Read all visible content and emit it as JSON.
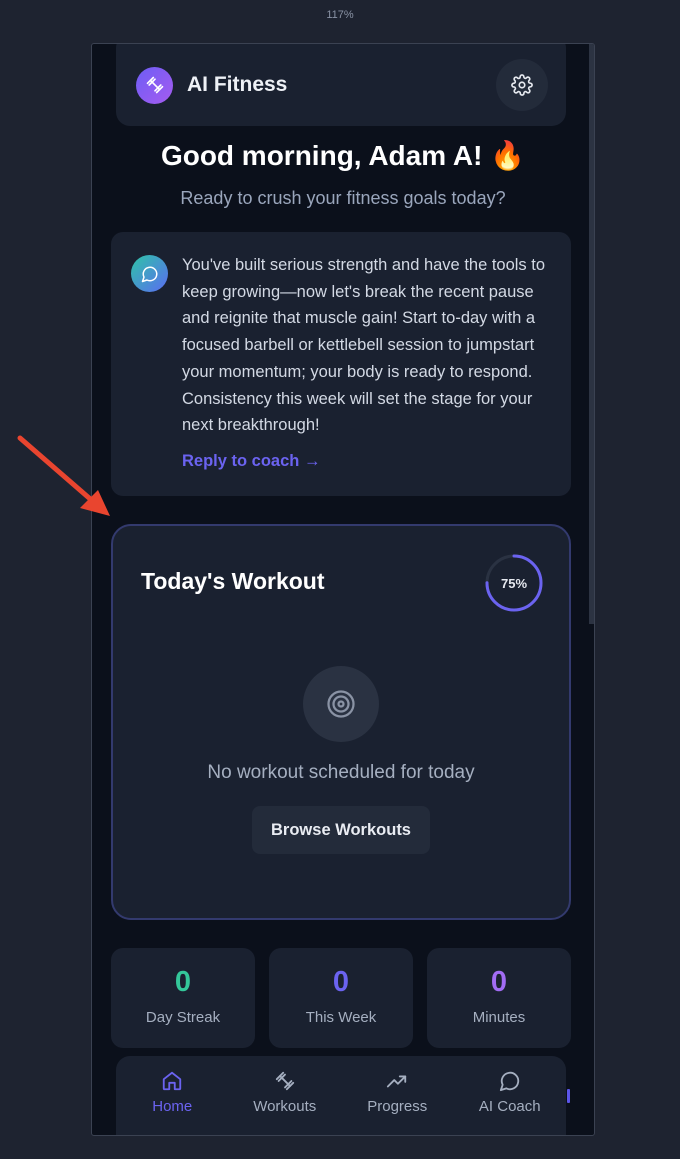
{
  "zoom": "117%",
  "header": {
    "app_name": "AI Fitness",
    "logo_icon": "dumbbell-icon",
    "settings_icon": "gear-icon"
  },
  "greeting": {
    "title": "Good morning, Adam A! 🔥",
    "subtitle": "Ready to crush your fitness goals today?"
  },
  "coach_card": {
    "avatar_icon": "chat-bubble-icon",
    "message": "You've built serious strength and have the tools to keep growing—now let's break the recent pause and reignite that muscle gain! Start to-day with a focused barbell or kettlebell session to jumpstart your momentum; your body is ready to respond. Consistency this week will set the stage for your next breakthrough!",
    "reply_link": "Reply to coach →"
  },
  "workout_card": {
    "title": "Today's Workout",
    "progress_label": "75%",
    "progress_fraction": 0.75,
    "empty_icon": "target-icon",
    "empty_text": "No workout scheduled for today",
    "browse_button": "Browse Workouts"
  },
  "stats": [
    {
      "value": "0",
      "label": "Day Streak",
      "color": "#34c79a"
    },
    {
      "value": "0",
      "label": "This Week",
      "color": "#6b63f0"
    },
    {
      "value": "0",
      "label": "Minutes",
      "color": "#a26cf4"
    }
  ],
  "nav": [
    {
      "label": "Home",
      "icon": "home-icon",
      "active": true
    },
    {
      "label": "Workouts",
      "icon": "dumbbell-icon",
      "active": false
    },
    {
      "label": "Progress",
      "icon": "trending-up-icon",
      "active": false
    },
    {
      "label": "AI Coach",
      "icon": "chat-bubble-icon",
      "active": false
    }
  ],
  "colors": {
    "accent": "#6b63f0",
    "annotation_arrow": "#e9452f",
    "background": "#0b101b",
    "card": "#1a2130"
  }
}
